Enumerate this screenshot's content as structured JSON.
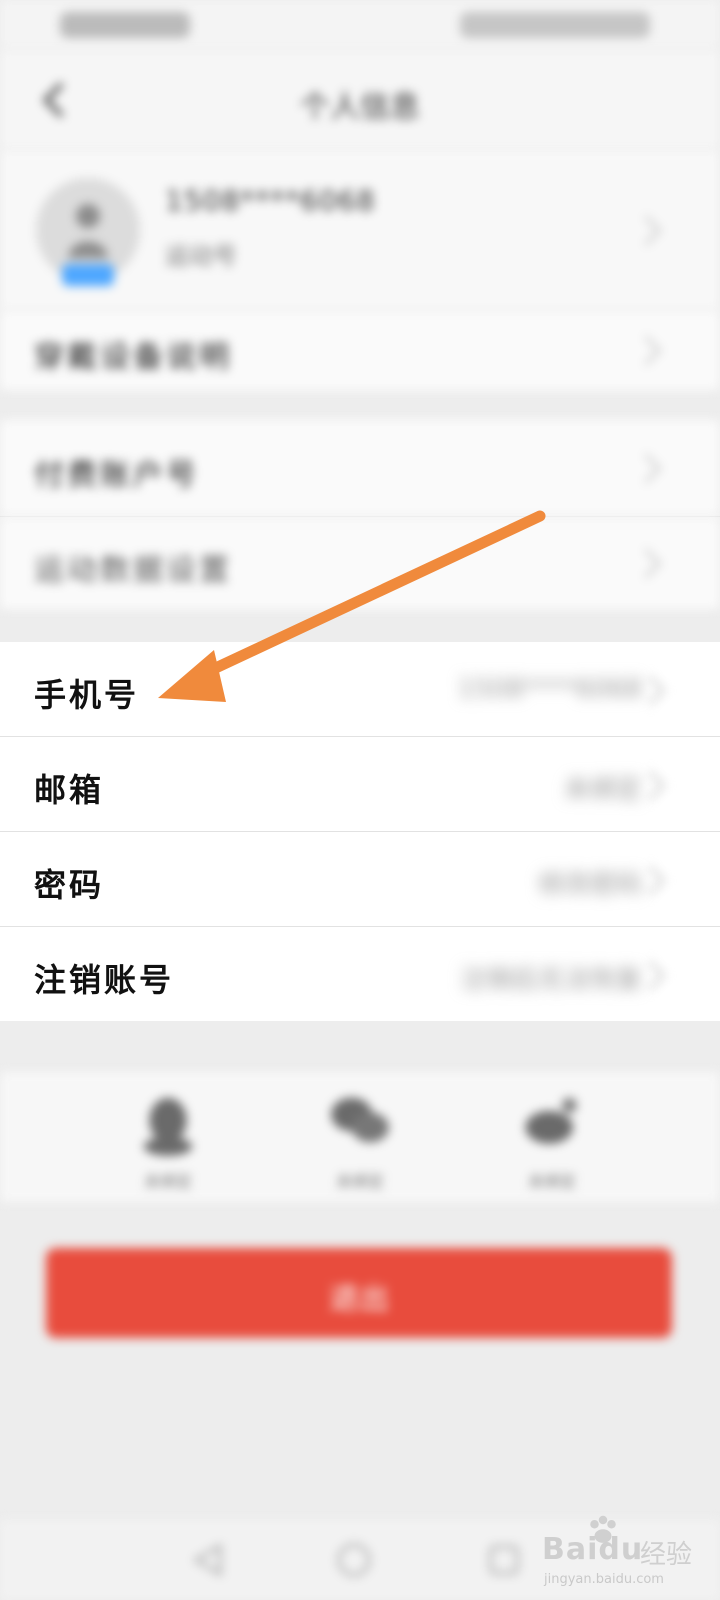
{
  "nav": {
    "title": "个人信息"
  },
  "profile": {
    "name": "1508****6068",
    "subtitle": "运动号"
  },
  "rows_blurred": [
    {
      "label": "穿戴设备说明"
    },
    {
      "label": "付费账户号"
    },
    {
      "label": "运动数据设置"
    }
  ],
  "rows_account": [
    {
      "label": "手机号",
      "value": "1508****6068"
    },
    {
      "label": "邮箱",
      "value": "未绑定"
    },
    {
      "label": "密码",
      "value": "修改密码"
    },
    {
      "label": "注销账号",
      "value": "注销后无法恢复"
    }
  ],
  "social": [
    {
      "icon": "qq-icon",
      "label": "未绑定"
    },
    {
      "icon": "wechat-icon",
      "label": "未绑定"
    },
    {
      "icon": "weibo-icon",
      "label": "未绑定"
    }
  ],
  "logout_label": "退出",
  "watermark": {
    "brand": "Baidu",
    "brand_cn": "经验",
    "url": "jingyan.baidu.com"
  },
  "colors": {
    "accent_red": "#e84c3d",
    "arrow_orange": "#f08a3c"
  }
}
